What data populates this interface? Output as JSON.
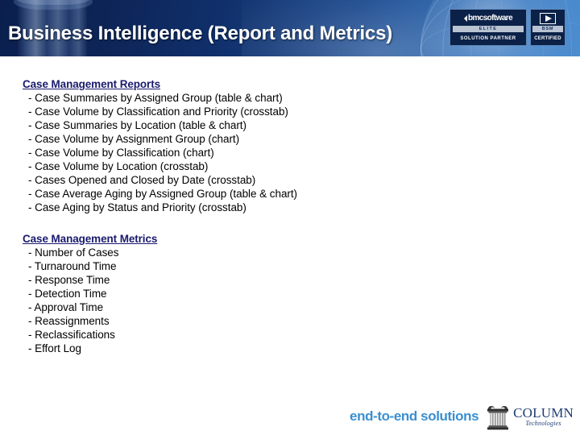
{
  "header": {
    "title": "Business Intelligence (Report and Metrics)",
    "accent_color": "#0d2456",
    "title_color": "#ffffff",
    "badges": [
      {
        "id": "bmc-elite-solution-partner",
        "brand": "bmcsoftware",
        "band": "ELITE",
        "foot": "SOLUTION PARTNER"
      },
      {
        "id": "bmc-bsm-certified",
        "brand": "",
        "band": "BSM",
        "foot": "CERTIFIED"
      }
    ]
  },
  "content": {
    "sections": [
      {
        "heading": "Case Management Reports",
        "heading_color": "#1a1a6e",
        "items": [
          "- Case Summaries by Assigned Group (table & chart)",
          "- Case Volume by Classification and Priority (crosstab)",
          "- Case Summaries by Location (table & chart)",
          "- Case Volume by Assignment Group (chart)",
          "- Case Volume by Classification (chart)",
          "- Case Volume by Location (crosstab)",
          "- Cases Opened and Closed by Date (crosstab)",
          "- Case Average Aging by Assigned Group (table & chart)",
          "- Case Aging by Status and Priority (crosstab)"
        ]
      },
      {
        "heading": "Case Management Metrics",
        "heading_color": "#1a1a6e",
        "items": [
          "- Number of Cases",
          "- Turnaround Time",
          "- Response Time",
          "- Detection Time",
          "- Approval Time",
          "- Reassignments",
          "- Reclassifications",
          "- Effort Log"
        ]
      }
    ]
  },
  "footer": {
    "tagline": "end-to-end solutions",
    "tagline_color": "#3a8fd0",
    "company_name": "COLUMN",
    "company_sub": "Technologies"
  }
}
